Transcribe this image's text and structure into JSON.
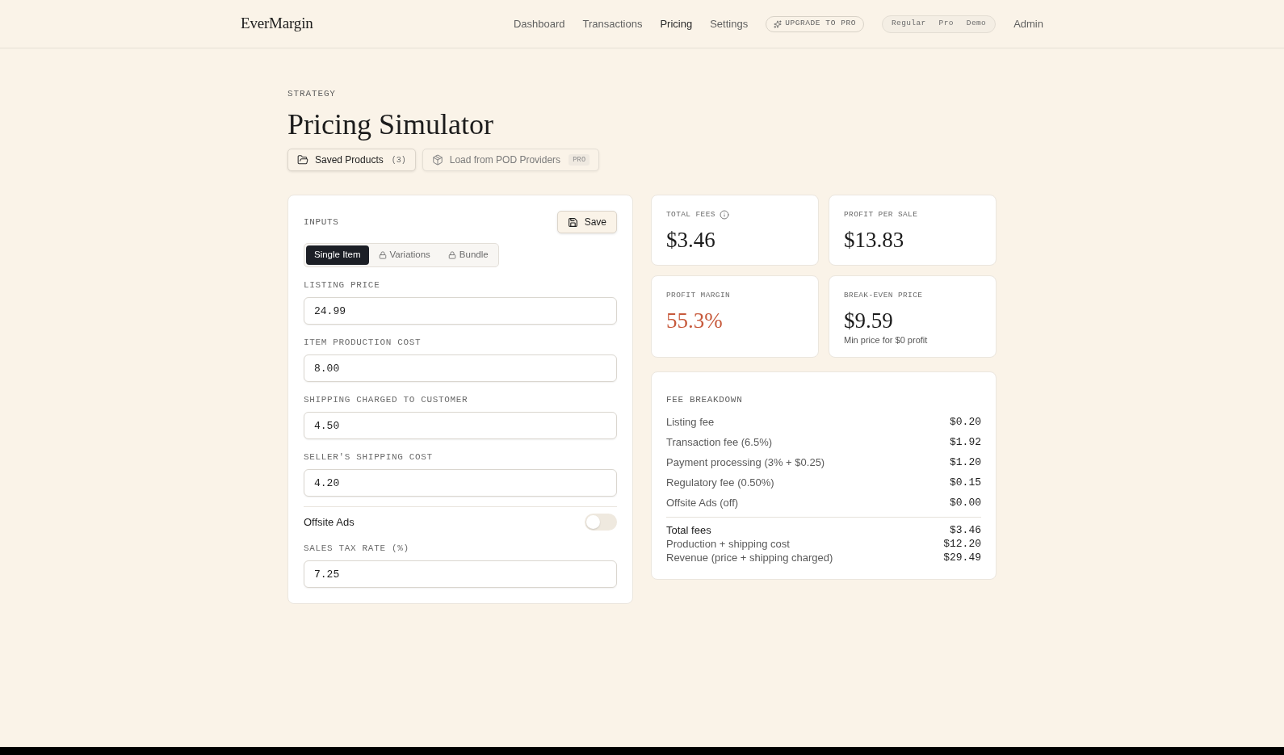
{
  "header": {
    "logo": "EverMargin",
    "nav": [
      {
        "label": "Dashboard",
        "selected": false
      },
      {
        "label": "Transactions",
        "selected": false
      },
      {
        "label": "Pricing",
        "selected": true
      },
      {
        "label": "Settings",
        "selected": false
      }
    ],
    "upgrade_button": "UPGRADE TO PRO",
    "modes": [
      {
        "label": "Regular",
        "selected": false
      },
      {
        "label": "Pro",
        "selected": false
      },
      {
        "label": "Demo",
        "selected": false
      }
    ],
    "user": "Admin"
  },
  "page": {
    "eyebrow": "STRATEGY",
    "title": "Pricing Simulator",
    "actions": [
      {
        "kind": "saved",
        "label": "Saved Products",
        "count": "(3)",
        "disabled": false
      },
      {
        "kind": "load",
        "label": "Load from POD Providers",
        "badge": "PRO",
        "disabled": true
      }
    ]
  },
  "inputs": {
    "title": "INPUTS",
    "save_button": "Save",
    "tabs": [
      {
        "label": "Single Item",
        "selected": true,
        "locked": false
      },
      {
        "label": "Variations",
        "selected": false,
        "locked": true
      },
      {
        "label": "Bundle",
        "selected": false,
        "locked": true
      }
    ],
    "fields": [
      {
        "kind": "number",
        "label": "LISTING PRICE",
        "value": "24.99"
      },
      {
        "kind": "number",
        "label": "ITEM PRODUCTION COST",
        "value": "8.00"
      },
      {
        "kind": "number",
        "label": "SHIPPING CHARGED TO CUSTOMER",
        "value": "4.50"
      },
      {
        "kind": "number",
        "label": "SELLER'S SHIPPING COST",
        "value": "4.20"
      },
      {
        "kind": "toggle",
        "label": "Offsite Ads",
        "on": false
      },
      {
        "kind": "number",
        "label": "SALES TAX RATE (%)",
        "value": "7.25"
      }
    ]
  },
  "stats": [
    {
      "label": "TOTAL FEES",
      "value": "$3.46",
      "info": true,
      "color": "#1c1c1c"
    },
    {
      "label": "PROFIT PER SALE",
      "value": "$13.83",
      "info": false,
      "color": "#1c1c1c"
    },
    {
      "label": "PROFIT MARGIN",
      "value": "55.3%",
      "info": false,
      "color": "#c75a3c"
    },
    {
      "label": "BREAK-EVEN PRICE",
      "value": "$9.59",
      "info": false,
      "color": "#1c1c1c",
      "note": "Min price for $0 profit"
    }
  ],
  "fee_breakdown": {
    "title": "FEE BREAKDOWN",
    "items": [
      {
        "label": "Listing fee",
        "value": "$0.20"
      },
      {
        "label": "Transaction fee (6.5%)",
        "value": "$1.92"
      },
      {
        "label": "Payment processing (3% + $0.25)",
        "value": "$1.20"
      },
      {
        "label": "Regulatory fee (0.50%)",
        "value": "$0.15"
      },
      {
        "label": "Offsite Ads (off)",
        "value": "$0.00"
      }
    ],
    "totals": [
      {
        "label": "Total fees",
        "value": "$3.46",
        "strong": true
      },
      {
        "label": "Production + shipping cost",
        "value": "$12.20",
        "strong": false
      },
      {
        "label": "Revenue (price + shipping charged)",
        "value": "$29.49",
        "strong": false
      }
    ]
  }
}
